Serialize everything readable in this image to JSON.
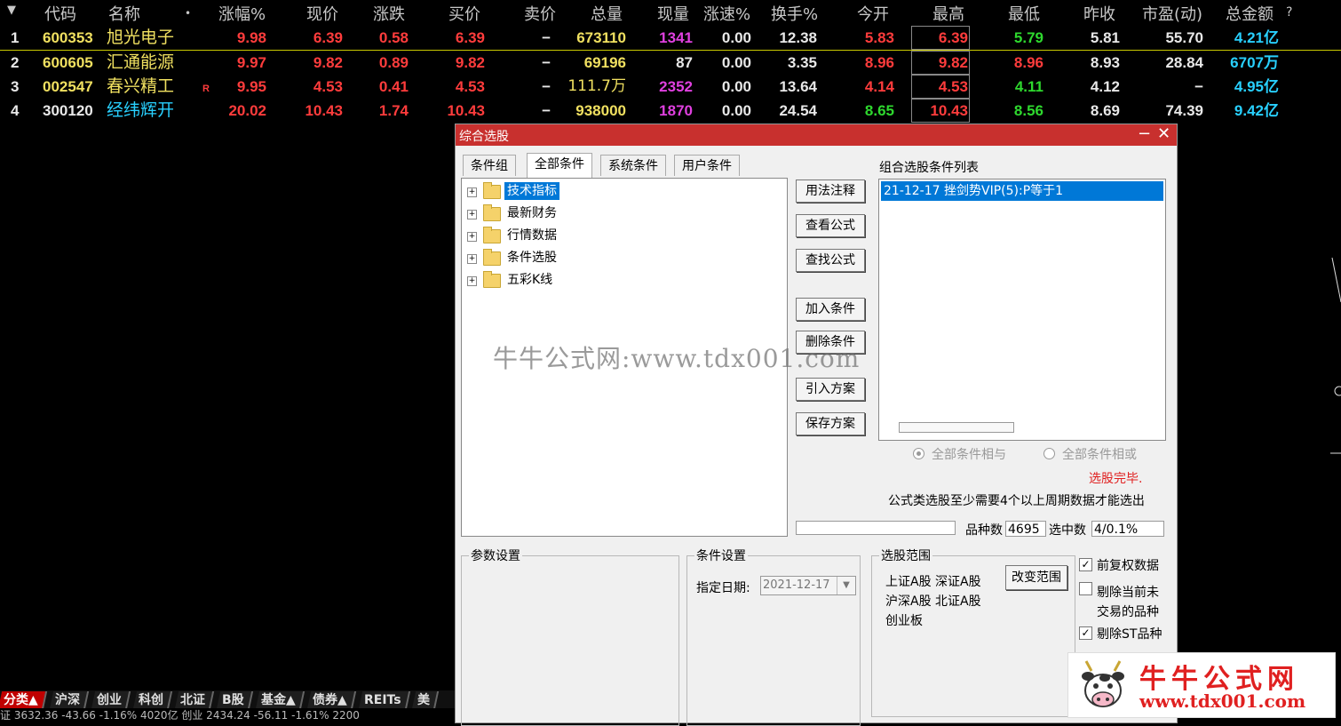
{
  "grid": {
    "headers": [
      "代码",
      "名称",
      "•",
      "涨幅%",
      "现价",
      "涨跌",
      "买价",
      "卖价",
      "总量",
      "现量",
      "涨速%",
      "换手%",
      "今开",
      "最高",
      "最低",
      "昨收",
      "市盈(动)",
      "总金额",
      "?"
    ],
    "rows": [
      {
        "idx": "1",
        "code": "600353",
        "name": "旭光电子",
        "flag": "",
        "pct": "9.98",
        "price": "6.39",
        "chg": "0.58",
        "bid": "6.39",
        "ask": "−",
        "vol": "673110",
        "cur": "1341",
        "speed": "0.00",
        "turn": "12.38",
        "open": "5.83",
        "high": "6.39",
        "low": "5.79",
        "prev": "5.81",
        "pe": "55.70",
        "amt": "4.21亿"
      },
      {
        "idx": "2",
        "code": "600605",
        "name": "汇通能源",
        "flag": "",
        "pct": "9.97",
        "price": "9.82",
        "chg": "0.89",
        "bid": "9.82",
        "ask": "−",
        "vol": "69196",
        "cur": "87",
        "speed": "0.00",
        "turn": "3.35",
        "open": "8.96",
        "high": "9.82",
        "low": "8.96",
        "prev": "8.93",
        "pe": "28.84",
        "amt": "6707万"
      },
      {
        "idx": "3",
        "code": "002547",
        "name": "春兴精工",
        "flag": "R",
        "pct": "9.95",
        "price": "4.53",
        "chg": "0.41",
        "bid": "4.53",
        "ask": "−",
        "vol": "111.7万",
        "cur": "2352",
        "speed": "0.00",
        "turn": "13.64",
        "open": "4.14",
        "high": "4.53",
        "low": "4.11",
        "prev": "4.12",
        "pe": "−",
        "amt": "4.95亿"
      },
      {
        "idx": "4",
        "code": "300120",
        "name": "经纬辉开",
        "flag": "",
        "pct": "20.02",
        "price": "10.43",
        "chg": "1.74",
        "bid": "10.43",
        "ask": "−",
        "vol": "938000",
        "cur": "1870",
        "speed": "0.00",
        "turn": "24.54",
        "open": "8.65",
        "high": "10.43",
        "low": "8.56",
        "prev": "8.69",
        "pe": "74.39",
        "amt": "9.42亿"
      }
    ]
  },
  "dialog": {
    "title": "综合选股",
    "tabs": [
      "条件组",
      "全部条件",
      "系统条件",
      "用户条件"
    ],
    "tree": [
      "技术指标",
      "最新财务",
      "行情数据",
      "条件选股",
      "五彩K线"
    ],
    "buttons": [
      "用法注释",
      "查看公式",
      "查找公式",
      "加入条件",
      "删除条件",
      "引入方案",
      "保存方案"
    ],
    "list_title": "组合选股条件列表",
    "list_items": [
      "21-12-17 挫剑势VIP(5):P等于1"
    ],
    "radio_and": "全部条件相与",
    "radio_or": "全部条件相或",
    "status": "选股完毕.",
    "note": "公式类选股至少需要4个以上周期数据才能选出",
    "count_label": "品种数",
    "count_value": "4695",
    "selected_label": "选中数",
    "selected_value": "4/0.1%",
    "param_title": "参数设置",
    "cond_title": "条件设置",
    "date_label": "指定日期:",
    "date_value": "2021-12-17",
    "range_title": "选股范围",
    "range_text": [
      "上证A股 深证A股",
      "沪深A股 北证A股",
      "创业板"
    ],
    "change_range": "改变范围",
    "opt_fuquan": "前复权数据",
    "opt_no_trade_1": "剔除当前未",
    "opt_no_trade_2": "交易的品种",
    "opt_st": "剔除ST品种"
  },
  "bottom": {
    "tabs": [
      "分类▲",
      "沪深",
      "创业",
      "科创",
      "北证",
      "B股",
      "基金▲",
      "债券▲",
      "REITs",
      "美"
    ],
    "status": "证 3632.36  -43.66  -1.16%  4020亿  创业 2434.24  -56.11  -1.61%  2200"
  },
  "watermark": "牛牛公式网:www.tdx001.com",
  "logo": {
    "title": "牛牛公式网",
    "url": "www.tdx001.com"
  },
  "colors": {
    "up": "#ff3c3c",
    "down": "#2ed82e",
    "title_bar": "#c8302e",
    "selection": "#0078d7"
  }
}
